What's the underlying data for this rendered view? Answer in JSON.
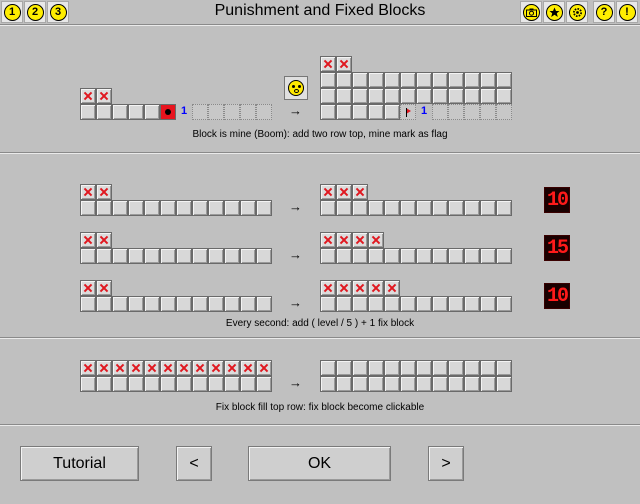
{
  "header": {
    "title": "Punishment and Fixed Blocks",
    "left_buttons": [
      "1",
      "2",
      "3"
    ],
    "right_buttons": [
      {
        "icon": "camera-icon"
      },
      {
        "icon": "star-icon"
      },
      {
        "icon": "gear-icon"
      },
      {
        "label": "?"
      },
      {
        "label": "!"
      }
    ]
  },
  "sections": [
    {
      "caption": "Block is mine (Boom): add two row top, mine mark as flag"
    },
    {
      "caption": "Every second: add ( level / 5 ) + 1 fix block"
    },
    {
      "caption": "Fix block fill top row: fix block become clickable"
    }
  ],
  "arrow": "→",
  "number_label": "1",
  "timers": [
    "10",
    "15",
    "10"
  ],
  "colors": {
    "mark": "#e01820",
    "number": "#0000ff",
    "lcd": "#ff1a1a",
    "face": "#ffe800",
    "accent": "#ffee00"
  },
  "buttons": {
    "tutorial": "Tutorial",
    "prev": "<",
    "ok": "OK",
    "next": ">"
  }
}
